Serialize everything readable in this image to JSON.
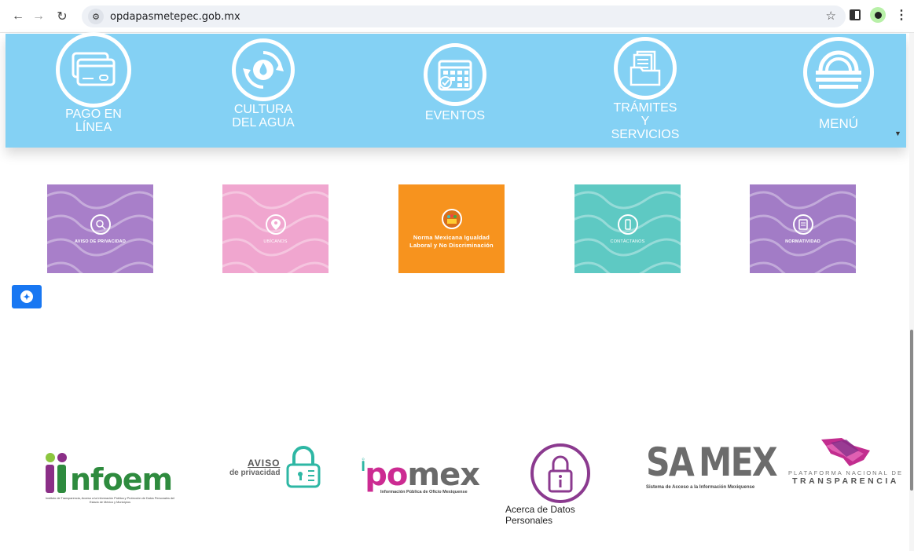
{
  "browser": {
    "url": "opdapasmetepec.gob.mx",
    "back_icon": "back-arrow-icon",
    "forward_icon": "forward-arrow-icon",
    "reload_icon": "reload-icon"
  },
  "topnav": {
    "items": [
      {
        "label_line1": "PAGO EN",
        "label_line2": "LÍNEA",
        "icon": "credit-card-icon"
      },
      {
        "label_line1": "CULTURA",
        "label_line2": "DEL AGUA",
        "icon": "water-drop-icon"
      },
      {
        "label_line1": "EVENTOS",
        "label_line2": "",
        "icon": "calendar-icon"
      },
      {
        "label_line1": "TRÁMITES",
        "label_line2": "Y SERVICIOS",
        "icon": "documents-icon"
      },
      {
        "label_line1": "MENÚ",
        "label_line2": "",
        "icon": "menu-logo-icon"
      }
    ],
    "bg_color": "#84d1f4"
  },
  "tiles": [
    {
      "label": "AVISO DE PRIVACIDAD",
      "color": "#a87fc9",
      "icon": "search-icon"
    },
    {
      "label": "UBÍCANOS",
      "color": "#f0a6cf",
      "icon": "location-pin-icon"
    },
    {
      "label": "Norma Mexicana Igualdad Laboral y No Discriminación",
      "color": "#f7931e",
      "icon": "people-icon"
    },
    {
      "label": "CONTÁCTANOS",
      "color": "#5ec9c3",
      "icon": "phone-icon"
    },
    {
      "label": "NORMATIVIDAD",
      "color": "#a27cc6",
      "icon": "document-icon"
    }
  ],
  "footer": {
    "infoem": {
      "name": "nfoem",
      "subtitle": "Instituto de Transparencia, Acceso a la Información Pública y Protección de Datos Personales del Estado de México y Municipios"
    },
    "aviso": {
      "word": "AVISO",
      "sub": "de privacidad"
    },
    "ipomex": {
      "pink": "po",
      "gray": "mex",
      "subtitle": "Información Pública de Oficio Mexiquense"
    },
    "acerca": {
      "label": "Acerca de Datos Personales"
    },
    "saimex": {
      "left": "SA",
      "right": "MEX",
      "subtitle": "Sistema de Acceso a la Información Mexiquense"
    },
    "pnt": {
      "line1": "PLATAFORMA NACIONAL DE",
      "line2": "TRANSPARENCIA"
    }
  }
}
